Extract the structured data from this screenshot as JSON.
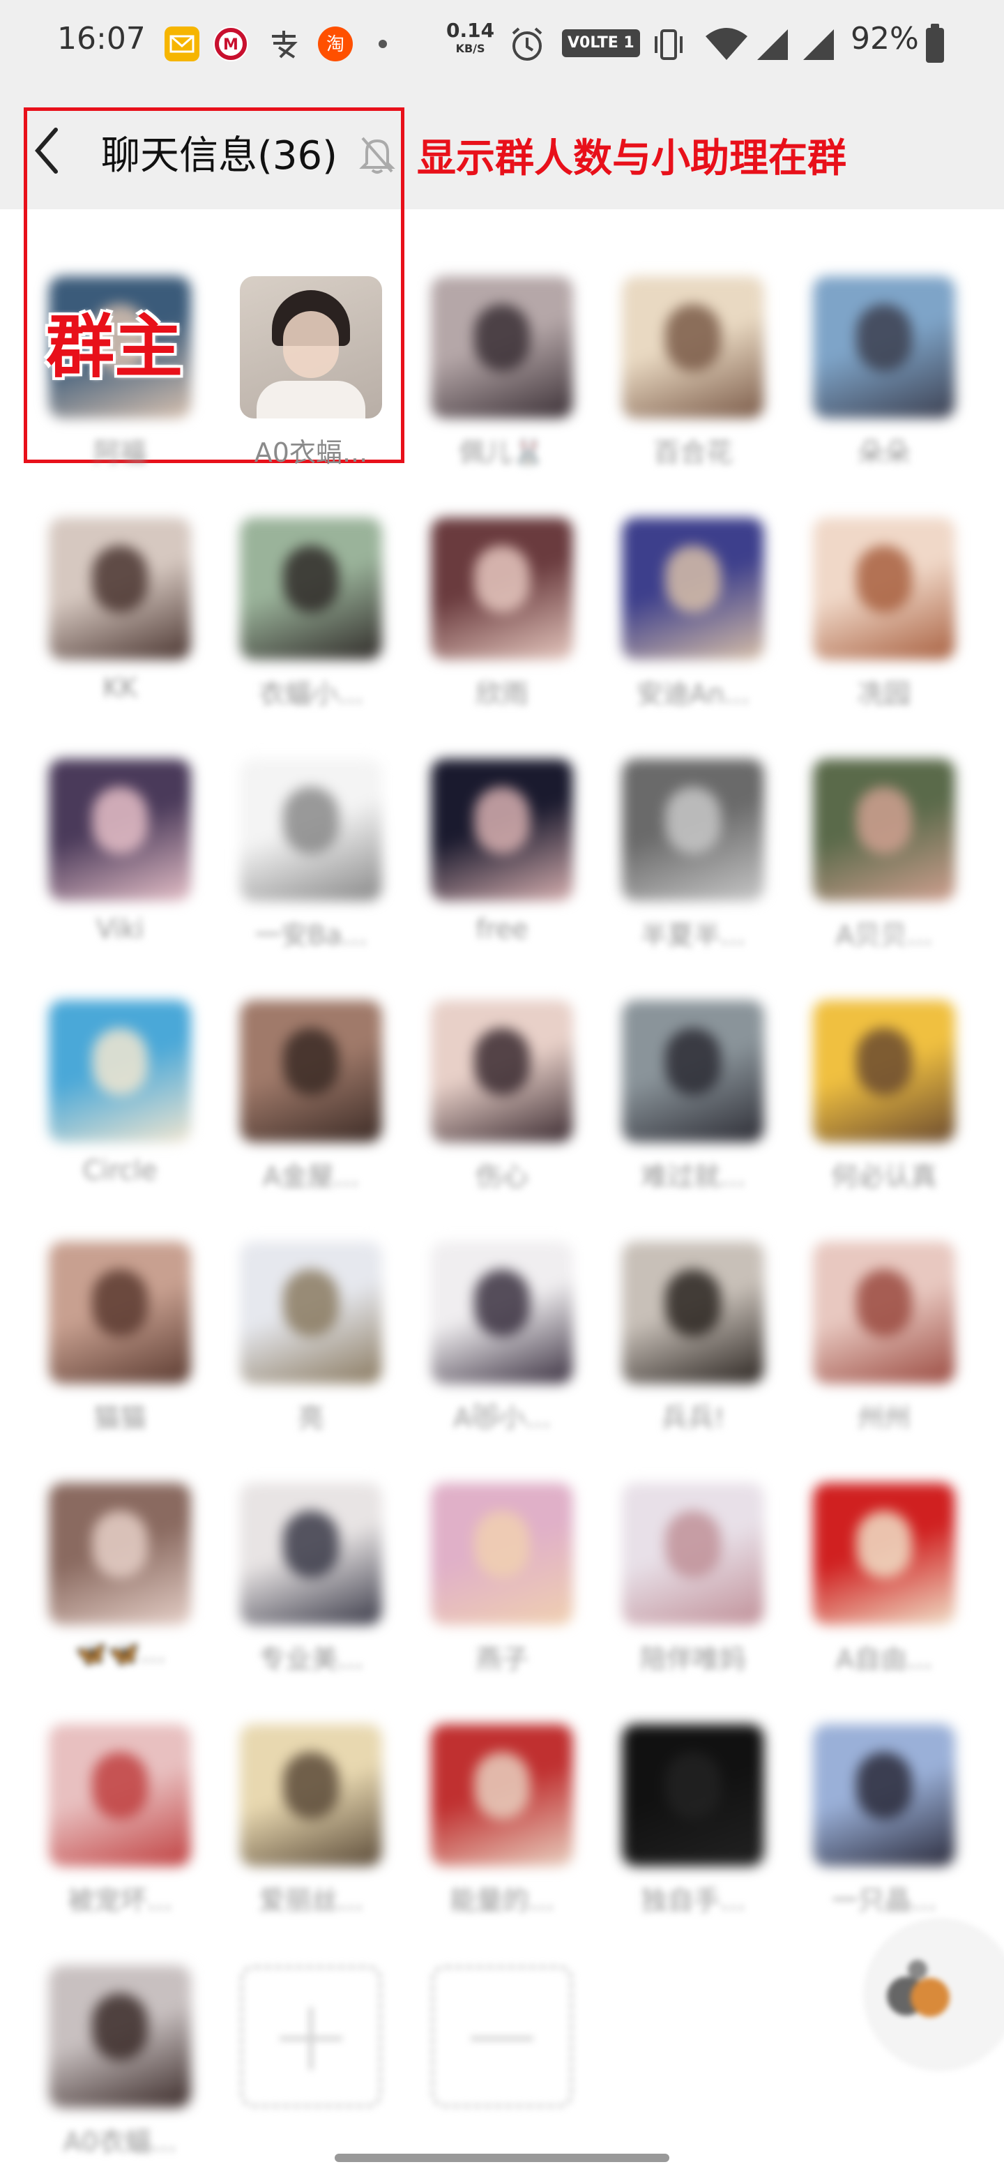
{
  "status_bar": {
    "time": "16:07",
    "net_speed_value": "0.14",
    "net_speed_unit": "KB/S",
    "volte": "V0LTE 1",
    "battery": "92%"
  },
  "nav": {
    "title": "聊天信息(36)",
    "back_icon": "chevron-left-icon",
    "mute_icon": "bell-off-icon"
  },
  "annotations": {
    "top_text": "显示群人数与小助理在群",
    "owner_label": "群主",
    "color": "#e8101a"
  },
  "members": [
    {
      "name": "阿福"
    },
    {
      "name": "A0衣蝠..."
    },
    {
      "name": "佩儿🐰"
    },
    {
      "name": "百合花"
    },
    {
      "name": "朵朵"
    },
    {
      "name": "KK"
    },
    {
      "name": "衣蝠小..."
    },
    {
      "name": "欣雨"
    },
    {
      "name": "安迪An..."
    },
    {
      "name": "冼园"
    },
    {
      "name": "Viki"
    },
    {
      "name": "一安Ba..."
    },
    {
      "name": "free"
    },
    {
      "name": "半夏半..."
    },
    {
      "name": "A贝贝..."
    },
    {
      "name": "Circle"
    },
    {
      "name": "A金屋..."
    },
    {
      "name": "伤心"
    },
    {
      "name": "难过就..."
    },
    {
      "name": "何必认真"
    },
    {
      "name": "猫猫"
    },
    {
      "name": "亮"
    },
    {
      "name": "A😻小..."
    },
    {
      "name": "兵兵!"
    },
    {
      "name": "州州"
    },
    {
      "name": "🦋🦋..."
    },
    {
      "name": "专业美..."
    },
    {
      "name": "燕子"
    },
    {
      "name": "陪伴唯妈"
    },
    {
      "name": "A自由..."
    },
    {
      "name": "被宠坏..."
    },
    {
      "name": "爱丽丝..."
    },
    {
      "name": "能量的..."
    },
    {
      "name": "独自手..."
    },
    {
      "name": "一只晶..."
    },
    {
      "name": "A0衣蝠..."
    }
  ],
  "actions": {
    "add_icon": "plus-icon",
    "remove_icon": "minus-icon"
  }
}
